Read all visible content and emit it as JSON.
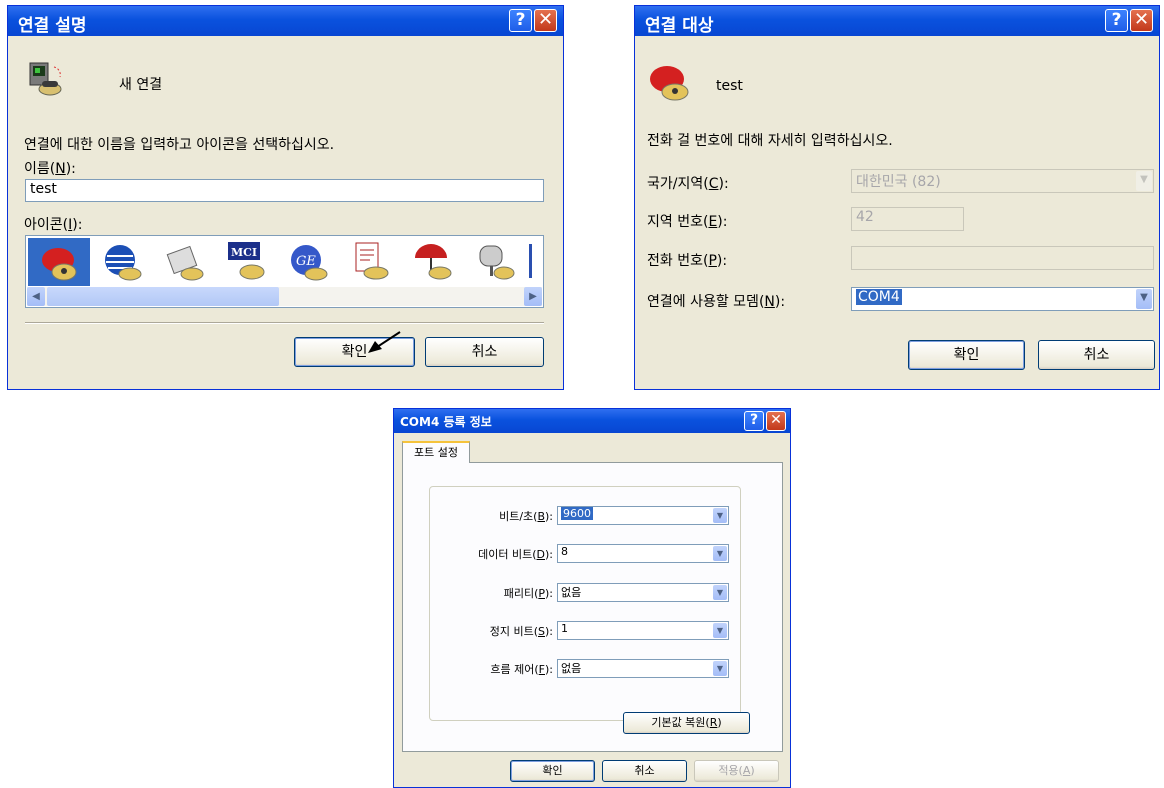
{
  "dialog1": {
    "title": "연결 설명",
    "connection_name_header": "새 연결",
    "instruction": "연결에 대한 이름을 입력하고 아이콘을 선택하십시오.",
    "name_label": "이름(",
    "name_key": "N",
    "name_label_end": "):",
    "name_value": "test",
    "icon_label": "아이콘(",
    "icon_key": "I",
    "icon_label_end": "):",
    "icons": [
      "red-phone-icon",
      "globe-phone-icon",
      "fax-phone-icon",
      "mci-phone-icon",
      "ge-phone-icon",
      "document-phone-icon",
      "umbrella-phone-icon",
      "mailbox-phone-icon"
    ],
    "ok": "확인",
    "cancel": "취소",
    "help_glyph": "?",
    "close_glyph": "✕"
  },
  "dialog2": {
    "title": "연결 대상",
    "connection_name": "test",
    "instruction": "전화 걸 번호에 대해 자세히 입력하십시오.",
    "country_label": "국가/지역(",
    "country_key": "C",
    "country_label_end": "):",
    "country_value": "대한민국 (82)",
    "area_label": "지역 번호(",
    "area_key": "E",
    "area_label_end": "):",
    "area_value": "42",
    "phone_label": "전화 번호(",
    "phone_key": "P",
    "phone_label_end": "):",
    "phone_value": "",
    "modem_label": "연결에 사용할 모뎀(",
    "modem_key": "N",
    "modem_label_end": "):",
    "modem_value": "COM4",
    "ok": "확인",
    "cancel": "취소",
    "help_glyph": "?",
    "close_glyph": "✕"
  },
  "dialog3": {
    "title": "COM4 등록 정보",
    "tab": "포트 설정",
    "bps_label": "비트/초(",
    "bps_key": "B",
    "bps_label_end": "):",
    "bps_value": "9600",
    "data_bits_label": "데이터 비트(",
    "data_bits_key": "D",
    "data_bits_label_end": "):",
    "data_bits_value": "8",
    "parity_label": "패리티(",
    "parity_key": "P",
    "parity_label_end": "):",
    "parity_value": "없음",
    "stop_bits_label": "정지 비트(",
    "stop_bits_key": "S",
    "stop_bits_label_end": "):",
    "stop_bits_value": "1",
    "flow_label": "흐름 제어(",
    "flow_key": "F",
    "flow_label_end": "):",
    "flow_value": "없음",
    "restore_defaults_label": "기본값 복원(",
    "restore_defaults_key": "R",
    "restore_defaults_label_end": ")",
    "ok": "확인",
    "cancel": "취소",
    "apply_label": "적용(",
    "apply_key": "A",
    "apply_label_end": ")",
    "help_glyph": "?",
    "close_glyph": "✕"
  },
  "colors": {
    "titlebar": "#0a52de",
    "dialog_bg": "#ece9d8",
    "selection": "#316ac5"
  }
}
